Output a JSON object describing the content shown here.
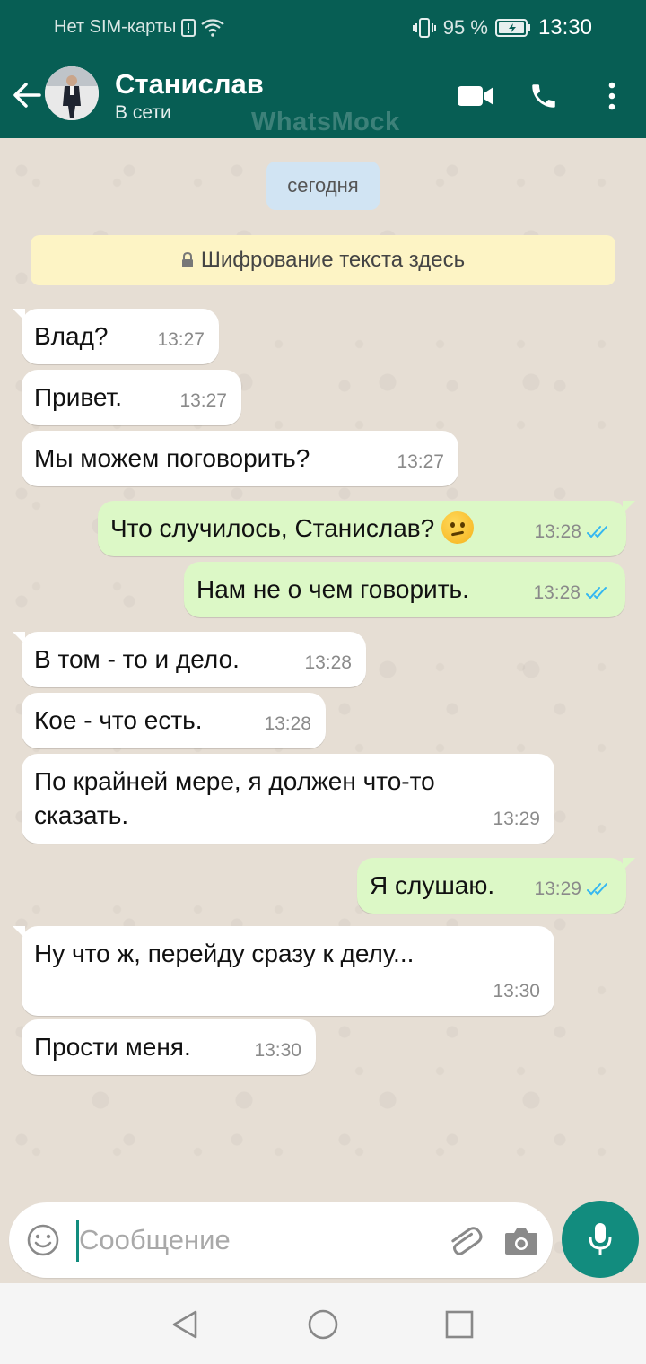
{
  "status_bar": {
    "carrier": "Нет SIM-карты",
    "battery": "95 %",
    "time": "13:30"
  },
  "header": {
    "contact_name": "Станислав",
    "contact_status": "В сети",
    "watermark": "WhatsMock",
    "icons": [
      "back-arrow-icon",
      "video-call-icon",
      "phone-icon",
      "more-vert-icon"
    ],
    "bg_color": "#075e54"
  },
  "chat": {
    "date_chip": "сегодня",
    "encryption_notice": "Шифрование текста здесь",
    "messages": [
      {
        "dir": "in",
        "text": "Влад?",
        "time": "13:27"
      },
      {
        "dir": "in",
        "text": "Привет.",
        "time": "13:27"
      },
      {
        "dir": "in",
        "text": "Мы можем поговорить?",
        "time": "13:27"
      },
      {
        "dir": "out",
        "text": "Что случилось, Станислав?",
        "emoji": "confused-face-emoji",
        "time": "13:28",
        "read": true
      },
      {
        "dir": "out",
        "text": "Нам не о чем говорить.",
        "time": "13:28",
        "read": true
      },
      {
        "dir": "in",
        "text": "В том - то и дело.",
        "time": "13:28"
      },
      {
        "dir": "in",
        "text": "Кое - что есть.",
        "time": "13:28"
      },
      {
        "dir": "in",
        "text": "По крайней мере, я должен что-то\nсказать.",
        "time": "13:29"
      },
      {
        "dir": "out",
        "text": "Я слушаю.",
        "time": "13:29",
        "read": true
      },
      {
        "dir": "in",
        "text": "Ну что ж, перейду сразу к делу...",
        "time": "13:30"
      },
      {
        "dir": "in",
        "text": "Прости меня.",
        "time": "13:30"
      }
    ]
  },
  "composer": {
    "placeholder": "Сообщение",
    "value": "",
    "accent_color": "#128c7e"
  }
}
